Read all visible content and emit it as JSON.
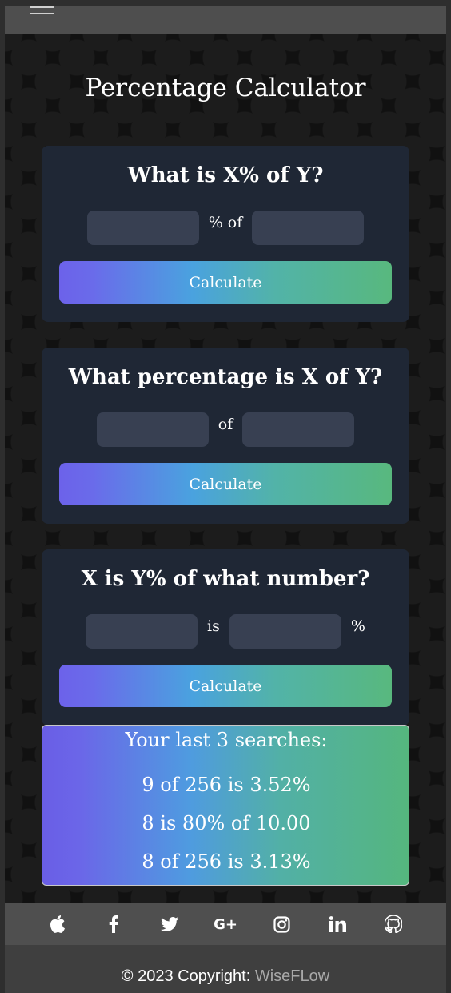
{
  "header": {
    "menu_icon": "hamburger-menu-icon"
  },
  "page": {
    "title": "Percentage Calculator"
  },
  "calculators": [
    {
      "title": "What is X% of Y?",
      "sep1": "% of",
      "sep2": "",
      "button": "Calculate",
      "x_value": "",
      "y_value": ""
    },
    {
      "title": "What percentage is X of Y?",
      "sep1": "of",
      "sep2": "",
      "button": "Calculate",
      "x_value": "",
      "y_value": ""
    },
    {
      "title": "X is Y% of what number?",
      "sep1": "is",
      "sep2": "%",
      "button": "Calculate",
      "x_value": "",
      "y_value": ""
    }
  ],
  "history": {
    "title": "Your last 3 searches:",
    "items": [
      "9 of 256 is 3.52%",
      "8 is 80% of 10.00",
      "8 of 256 is 3.13%"
    ]
  },
  "footer": {
    "icons": [
      "apple-icon",
      "facebook-icon",
      "twitter-icon",
      "google-plus-icon",
      "instagram-icon",
      "linkedin-icon",
      "github-icon"
    ],
    "copyright": "© 2023 Copyright: ",
    "brand": "WiseFLow"
  },
  "colors": {
    "card_bg": "#1f2735",
    "input_bg": "#384052",
    "gradient_start": "#6c62ea",
    "gradient_mid": "#4aa2df",
    "gradient_end": "#58b87e"
  }
}
